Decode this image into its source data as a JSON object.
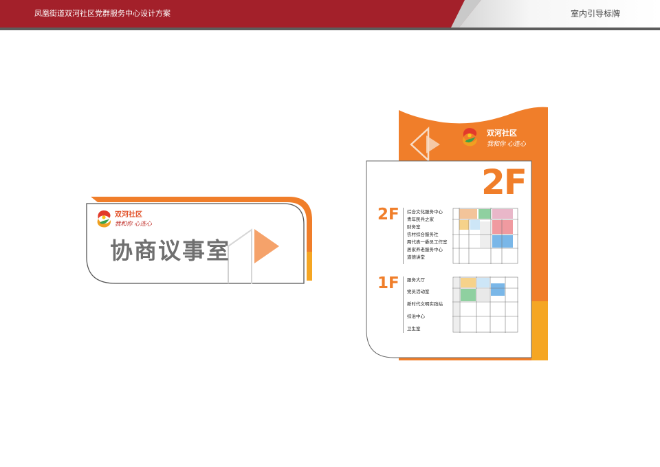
{
  "header": {
    "project_title": "凤凰街道双河社区党群服务中心设计方案",
    "section_title": "室内引导标牌"
  },
  "logo": {
    "name": "双河社区",
    "slogan": "我和你 心连心"
  },
  "door_sign": {
    "room_name": "协商议事室"
  },
  "directory": {
    "current_floor": "2F",
    "floors": [
      {
        "label": "2F",
        "rooms": [
          "综合文化服务中心",
          "青年民兵之家",
          "财务室",
          "农村综合服务社",
          "两代表一委员工作室",
          "居家养老服务中心",
          "道德讲堂"
        ]
      },
      {
        "label": "1F",
        "rooms": [
          "服务大厅",
          "党员活动室",
          "新时代文明实践站",
          "综治中心",
          "卫生室"
        ]
      }
    ]
  },
  "colors": {
    "header_red": "#a3202a",
    "brand_orange": "#f07e2a",
    "accent_yellow": "#f5a623",
    "text_gray": "#6f6f6f"
  }
}
